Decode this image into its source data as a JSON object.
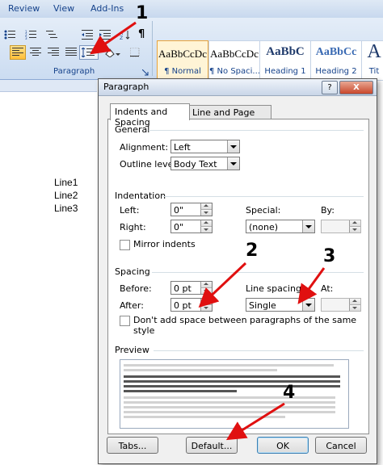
{
  "ribbon": {
    "tabs": [
      "Review",
      "View",
      "Add-Ins"
    ],
    "group_label": "Paragraph",
    "styles": [
      {
        "sample": "AaBbCcDc",
        "name": "¶ Normal"
      },
      {
        "sample": "AaBbCcDc",
        "name": "¶ No Spaci..."
      },
      {
        "sample": "AaBbC",
        "name": "Heading 1"
      },
      {
        "sample": "AaBbCc",
        "name": "Heading 2"
      },
      {
        "sample": "A",
        "name": "Tit"
      }
    ],
    "pilcrow": "¶"
  },
  "document": {
    "lines": [
      "Line1",
      "Line2",
      "Line3"
    ]
  },
  "dialog": {
    "title": "Paragraph",
    "help_button": "?",
    "close_button": "X",
    "tabs": [
      "Indents and Spacing",
      "Line and Page Breaks"
    ],
    "general": {
      "heading": "General",
      "alignment_label": "Alignment:",
      "alignment_value": "Left",
      "outline_label": "Outline level:",
      "outline_value": "Body Text"
    },
    "indentation": {
      "heading": "Indentation",
      "left_label": "Left:",
      "left_value": "0\"",
      "right_label": "Right:",
      "right_value": "0\"",
      "special_label": "Special:",
      "special_value": "(none)",
      "by_label": "By:",
      "mirror_label": "Mirror indents"
    },
    "spacing": {
      "heading": "Spacing",
      "before_label": "Before:",
      "before_value": "0 pt",
      "after_label": "After:",
      "after_value": "0 pt",
      "line_spacing_label": "Line spacing:",
      "line_spacing_value": "Single",
      "at_label": "At:",
      "dont_add_label": "Don't add space between paragraphs of the same style"
    },
    "preview": {
      "heading": "Preview"
    },
    "buttons": {
      "tabs": "Tabs...",
      "default": "Default...",
      "ok": "OK",
      "cancel": "Cancel"
    }
  },
  "annotations": {
    "numbers": [
      "1",
      "2",
      "3",
      "4"
    ],
    "arrow_color": "#e01010"
  }
}
